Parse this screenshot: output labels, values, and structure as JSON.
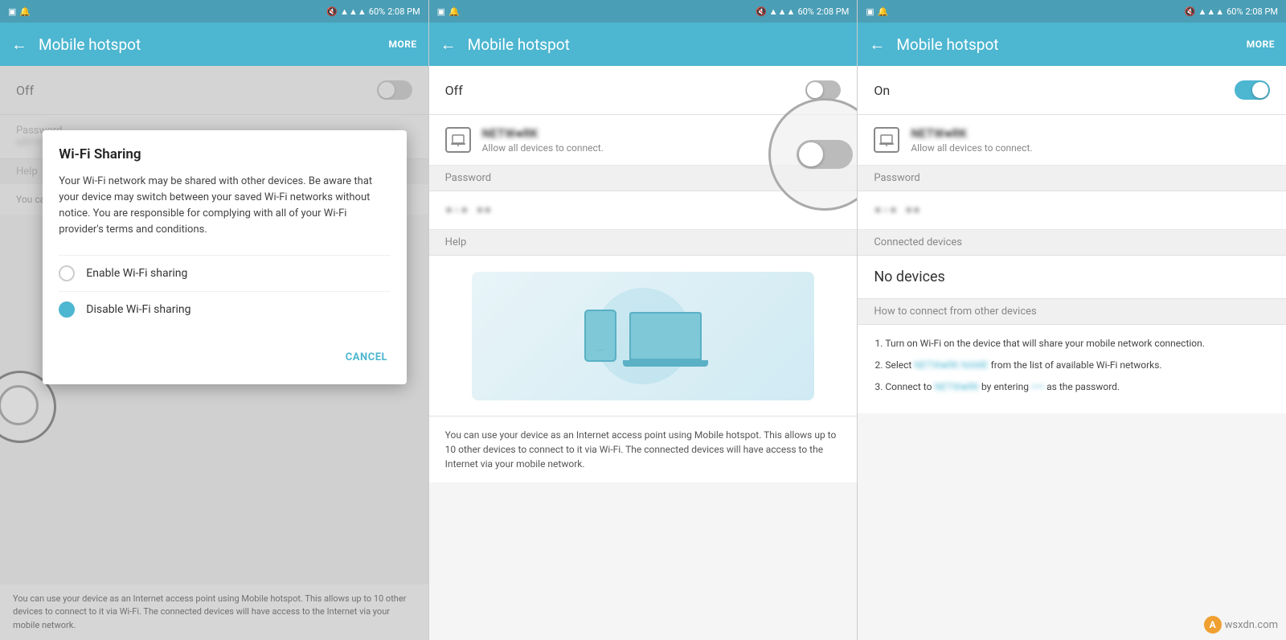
{
  "panels": [
    {
      "id": "panel1",
      "statusBar": {
        "left": [
          "sim-icon",
          "notification-icon"
        ],
        "right": "60% 2:08 PM",
        "time": "2:08 PM",
        "battery": "60%"
      },
      "topBar": {
        "title": "Mobile hotspot",
        "moreLabel": "MORE",
        "backArrow": "←"
      },
      "toggle": {
        "label": "Off",
        "state": "off"
      },
      "dialog": {
        "title": "Wi-Fi Sharing",
        "body": "Your Wi-Fi network may be shared with other devices. Be aware that your device may switch between your saved Wi-Fi networks without notice. You are responsible for complying with all of your Wi-Fi provider's terms and conditions.",
        "options": [
          {
            "label": "Enable Wi-Fi sharing",
            "selected": false
          },
          {
            "label": "Disable Wi-Fi sharing",
            "selected": true
          }
        ],
        "cancelLabel": "CANCEL"
      },
      "helpText": "You can use your device as an Internet access point using Mobile hotspot. This allows up to 10 other devices to connect to it via Wi-Fi. The connected devices will have access to the Internet via your mobile network."
    },
    {
      "id": "panel2",
      "statusBar": {
        "time": "2:08 PM",
        "battery": "60%"
      },
      "topBar": {
        "title": "Mobile hotspot",
        "moreLabel": "",
        "backArrow": "←"
      },
      "toggle": {
        "label": "Off",
        "state": "off"
      },
      "ssid": {
        "name": "NETWORK_NAME",
        "sub": "Allow all devices to connect."
      },
      "passwordLabel": "Password",
      "passwordValue": "••• ••",
      "helpLabel": "Help",
      "helpText": "You can use your device as an Internet access point using Mobile hotspot. This allows up to 10 other devices to connect to it via Wi-Fi. The connected devices will have access to the Internet via your mobile network."
    },
    {
      "id": "panel3",
      "statusBar": {
        "time": "2:08 PM",
        "battery": "60%"
      },
      "topBar": {
        "title": "Mobile hotspot",
        "moreLabel": "MORE",
        "backArrow": "←"
      },
      "toggle": {
        "label": "On",
        "state": "on"
      },
      "ssid": {
        "name": "NETWORK_NAME",
        "sub": "Allow all devices to connect."
      },
      "passwordLabel": "Password",
      "passwordValue": "••• ••",
      "connectedDevicesLabel": "Connected devices",
      "noDevicesLabel": "No devices",
      "howToLabel": "How to connect from other devices",
      "howToSteps": [
        "Turn on Wi-Fi on the device that will share your mobile network connection.",
        "Select [NETWORK] from the list of available Wi-Fi networks.",
        "Connect to [NETWORK] by entering [PASSWORD] as the password."
      ]
    }
  ],
  "watermark": {
    "text": "wsxdn.com",
    "icon": "A"
  }
}
